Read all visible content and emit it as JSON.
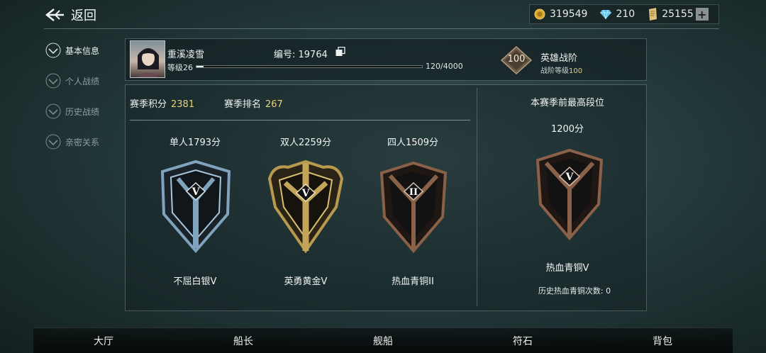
{
  "header": {
    "back_label": "返回",
    "currencies": [
      {
        "name": "gold-coin-icon",
        "value": "319549"
      },
      {
        "name": "diamond-icon",
        "value": "210"
      },
      {
        "name": "ticket-icon",
        "value": "25155"
      }
    ],
    "plus_label": "+"
  },
  "sidebar": {
    "items": [
      {
        "label": "基本信息",
        "active": true
      },
      {
        "label": "个人战绩",
        "active": false
      },
      {
        "label": "历史战绩",
        "active": false
      },
      {
        "label": "亲密关系",
        "active": false
      }
    ]
  },
  "profile": {
    "name": "重溪凌雪",
    "level_label": "等级26",
    "xp_text": "120/4000",
    "xp_fraction": 0.03,
    "id_label": "编号: 19764",
    "hero_rank_value": "100",
    "hero_rank_title": "英雄战阶",
    "hero_rank_level_prefix": "战阶等级",
    "hero_rank_level_value": "100"
  },
  "season": {
    "points_label": "赛季积分",
    "points_value": "2381",
    "rank_label": "赛季排名",
    "rank_value": "267"
  },
  "modes": [
    {
      "score": "单人1793分",
      "tier": "不屈白银V",
      "numeral": "V",
      "style": "silver"
    },
    {
      "score": "双人2259分",
      "tier": "英勇黄金V",
      "numeral": "V",
      "style": "gold"
    },
    {
      "score": "四人1509分",
      "tier": "热血青铜II",
      "numeral": "II",
      "style": "bronze"
    }
  ],
  "best": {
    "title": "本赛季前最高段位",
    "score": "1200分",
    "tier": "热血青铜V",
    "numeral": "V",
    "count_label": "历史热血青铜次数: 0"
  },
  "bottom_nav": [
    "大厅",
    "船长",
    "舰船",
    "符石",
    "背包"
  ],
  "colors": {
    "accent_gold": "#e6d477",
    "silver": "#7fa2bd",
    "gold": "#b89a4e",
    "bronze": "#8a6148"
  }
}
